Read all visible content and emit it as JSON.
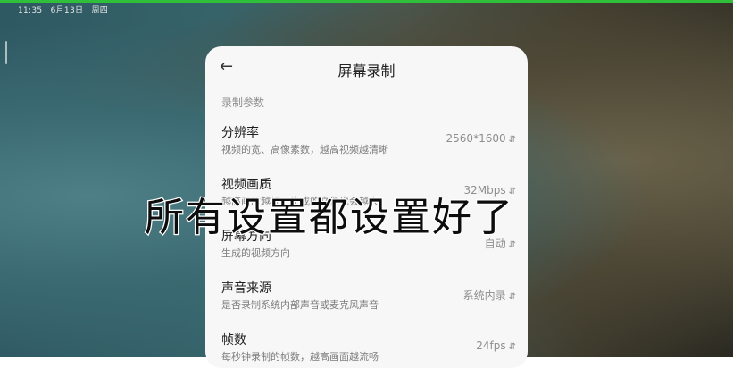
{
  "status_bar": {
    "time": "11:35",
    "date": "6月13日",
    "weekday": "周四"
  },
  "header": {
    "title": "屏幕录制",
    "back_icon": "back-arrow-icon"
  },
  "section_label": "录制参数",
  "settings": [
    {
      "name": "分辨率",
      "desc": "视频的宽、高像素数，越高视频越清晰",
      "value": "2560*1600"
    },
    {
      "name": "视频画质",
      "desc": "越高画质越好，生成的文件也会越大",
      "value": "32Mbps"
    },
    {
      "name": "屏幕方向",
      "desc": "生成的视频方向",
      "value": "自动"
    },
    {
      "name": "声音来源",
      "desc": "是否录制系统内部声音或麦克风声音",
      "value": "系统内录"
    },
    {
      "name": "帧数",
      "desc": "每秒钟录制的帧数，越高画面越流畅",
      "value": "24fps"
    }
  ],
  "overlay_caption": "所有设置都设置好了",
  "colors": {
    "accent_line": "#2fbf3a",
    "panel_bg": "#f7f7f7"
  }
}
